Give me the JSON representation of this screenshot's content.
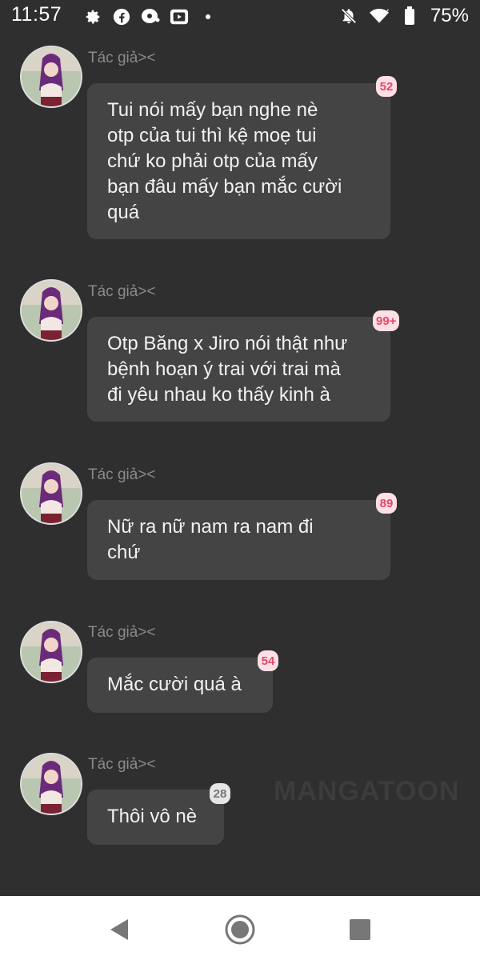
{
  "status": {
    "time": "11:57",
    "battery": "75%",
    "left_icons": [
      "gear-icon",
      "facebook-icon",
      "messenger-icon",
      "tv-icon",
      "dot-icon"
    ],
    "right_icons": [
      "notifications-off-icon",
      "wifi-icon",
      "battery-icon"
    ]
  },
  "messages": [
    {
      "author": "Tác giả><",
      "lines": [
        "Tui nói mấy bạn nghe nè",
        "otp của tui thì kệ moẹ tui",
        "chứ ko phải otp của mấy",
        "bạn đâu mấy bạn mắc cười",
        "quá"
      ],
      "badge": "52"
    },
    {
      "author": "Tác giả><",
      "lines": [
        "Otp Băng x Jiro nói thật như",
        "bệnh hoạn ý trai với trai mà",
        "đi yêu nhau ko thấy kinh à"
      ],
      "badge": "99+"
    },
    {
      "author": "Tác giả><",
      "lines": [
        "Nữ ra nữ nam ra nam đi",
        "chứ"
      ],
      "badge": "89"
    },
    {
      "author": "Tác giả><",
      "lines": [
        "Mắc cười quá à"
      ],
      "badge": "54"
    },
    {
      "author": "Tác giả><",
      "lines": [
        "Thôi vô nè"
      ],
      "badge": "28"
    }
  ],
  "watermark": "MANGATOON",
  "nav": [
    "back-icon",
    "home-icon",
    "recents-icon"
  ]
}
